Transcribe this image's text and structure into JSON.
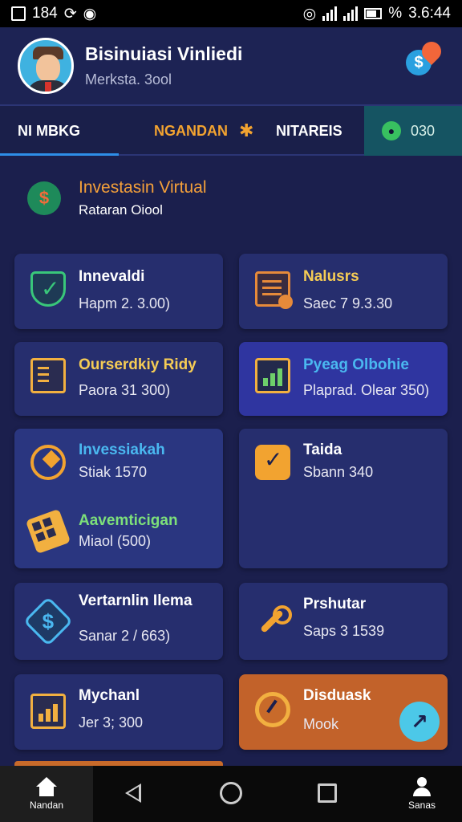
{
  "status_bar": {
    "left_text": "184",
    "right_text": "%",
    "time": "3.6:44"
  },
  "header": {
    "user_name": "Bisinuiasi Vinliedi",
    "user_sub": "Merksta. 3ool",
    "action_icon": "dollar-chat-icon"
  },
  "tabs": {
    "items": [
      {
        "label": "NI MBKG"
      },
      {
        "label": "NGANDAN"
      },
      {
        "label": "NITAREIS"
      }
    ],
    "score": "030"
  },
  "section": {
    "title": "Investasin Virtual",
    "subtitle": "Rataran Oiool"
  },
  "cards": [
    {
      "title": "Innevaldi",
      "sub": "Hapm 2. 3.00)",
      "icon": "shield-check-icon"
    },
    {
      "title": "Nalusrs",
      "sub": "Saec 7 9.3.30",
      "icon": "document-icon"
    },
    {
      "title": "Ourserdkiy Ridy",
      "sub": "Paora 31 300)",
      "icon": "checklist-icon"
    },
    {
      "title": "Pyeag Olbohie",
      "sub": "Plaprad. Olear 350)",
      "icon": "bar-chart-icon"
    },
    {
      "title": "Invessiakah",
      "sub": "Stiak 1570",
      "icon": "cycle-icon"
    },
    {
      "title": "Aavemticigan",
      "sub": "Miaol (500)",
      "icon": "grid-icon"
    },
    {
      "title": "Taida",
      "sub": "Sbann 340",
      "icon": "checkmark-icon"
    },
    {
      "title": "Vertarnlin Ilema",
      "sub": "Sanar 2 / 663)",
      "icon": "dollar-icon"
    },
    {
      "title": "Prshutar",
      "sub": "Saps 3 1539",
      "icon": "tool-icon"
    },
    {
      "title": "Mychanl",
      "sub": "Jer 3; 300",
      "icon": "bar-graph-icon"
    },
    {
      "title": "Disduask",
      "sub": "Mook",
      "icon": "gauge-icon"
    }
  ],
  "fab_icon": "arrow-up-right-icon",
  "nav": {
    "home_label": "Nandan",
    "profile_label": "Sanas"
  },
  "colors": {
    "background": "#1b1f4d",
    "card": "#262e6e",
    "accent_orange": "#f4a03a",
    "accent_blue": "#4ab8f0",
    "accent_green": "#7de07a"
  }
}
